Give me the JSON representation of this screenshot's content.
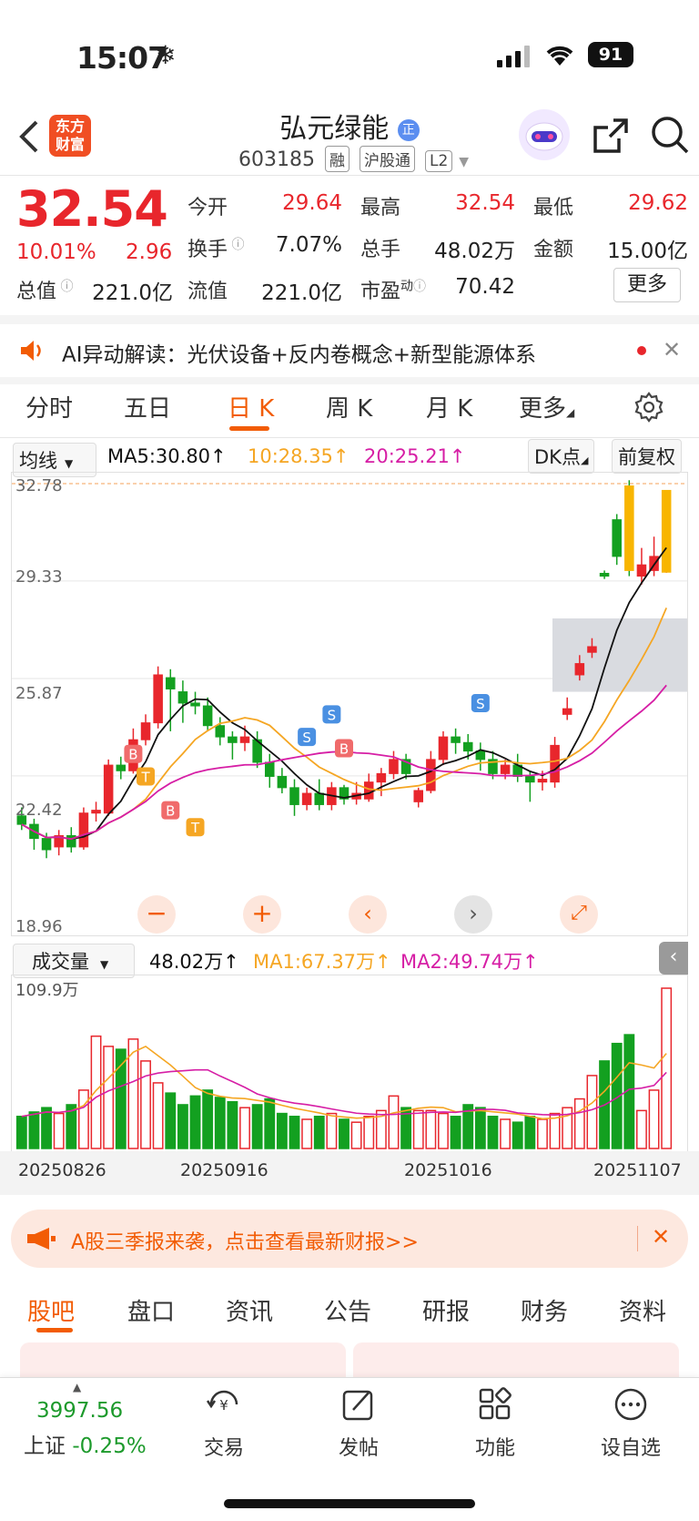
{
  "status": {
    "time": "15:07",
    "battery": "91"
  },
  "header": {
    "logo_line1": "东方",
    "logo_line2": "财富",
    "title": "弘元绿能",
    "title_badge": "正",
    "code": "603185",
    "tags": [
      "融",
      "沪股通",
      "L2"
    ]
  },
  "quote": {
    "price": "32.54",
    "change_pct": "10.01%",
    "change": "2.96",
    "stats": [
      {
        "label": "今开",
        "value": "29.64"
      },
      {
        "label": "最高",
        "value": "32.54"
      },
      {
        "label": "最低",
        "value": "29.62"
      },
      {
        "label": "换手",
        "value": "7.07%"
      },
      {
        "label": "总手",
        "value": "48.02万"
      },
      {
        "label": "金额",
        "value": "15.00亿"
      },
      {
        "label": "总值",
        "value": "221.0亿"
      },
      {
        "label": "流值",
        "value": "221.0亿"
      },
      {
        "label": "市盈",
        "value": "70.42"
      }
    ],
    "pe_sup": "动",
    "more": "更多"
  },
  "ai_banner": {
    "text": "AI异动解读：光伏设备+反内卷概念+新型能源体系"
  },
  "tabs": [
    "分时",
    "五日",
    "日 K",
    "周 K",
    "月 K",
    "更多"
  ],
  "kline": {
    "indicator": "均线",
    "ma5": "MA5:30.80",
    "ma10": "10:28.35",
    "ma20": "20:25.21",
    "dk_label": "DK点",
    "fq_label": "前复权",
    "y_ticks": [
      "32.78",
      "29.33",
      "25.87",
      "22.42",
      "18.96"
    ],
    "markers": [
      "B",
      "T",
      "B",
      "T",
      "S",
      "S",
      "B",
      "S"
    ]
  },
  "volume": {
    "indicator": "成交量",
    "value": "48.02万",
    "ma1": "MA1:67.37万",
    "ma2": "MA2:49.74万",
    "max_label": "109.9万",
    "dates": [
      "20250826",
      "20250916",
      "20251016",
      "20251107"
    ]
  },
  "colors": {
    "up": "#e8262c",
    "down": "#13a020",
    "ma5": "#111111",
    "ma10": "#f5a623",
    "ma20": "#d61ea5",
    "accent": "#f25c05"
  },
  "chart_data": {
    "type": "candlestick",
    "y_range": [
      18.96,
      32.78
    ],
    "candles": [
      [
        21.0,
        20.7,
        21.3,
        20.5
      ],
      [
        20.7,
        20.2,
        20.9,
        19.8
      ],
      [
        20.2,
        19.8,
        20.4,
        19.5
      ],
      [
        19.9,
        20.3,
        20.5,
        19.6
      ],
      [
        20.3,
        19.9,
        20.6,
        19.7
      ],
      [
        19.9,
        21.1,
        21.3,
        19.8
      ],
      [
        21.1,
        21.2,
        21.5,
        20.8
      ],
      [
        21.1,
        22.8,
        23.0,
        21.0
      ],
      [
        22.8,
        22.6,
        23.1,
        22.3
      ],
      [
        22.6,
        23.7,
        24.1,
        22.5
      ],
      [
        23.7,
        24.3,
        24.6,
        23.5
      ],
      [
        24.3,
        26.0,
        26.3,
        24.1
      ],
      [
        25.9,
        25.5,
        26.2,
        24.0
      ],
      [
        25.4,
        25.0,
        25.8,
        24.3
      ],
      [
        25.0,
        24.9,
        25.4,
        24.6
      ],
      [
        24.9,
        24.2,
        25.2,
        24.0
      ],
      [
        24.2,
        23.8,
        24.5,
        23.5
      ],
      [
        23.8,
        23.6,
        24.0,
        23.0
      ],
      [
        23.6,
        23.8,
        24.2,
        23.3
      ],
      [
        23.7,
        22.9,
        24.0,
        22.7
      ],
      [
        22.9,
        22.4,
        23.2,
        22.0
      ],
      [
        22.4,
        22.0,
        22.7,
        21.8
      ],
      [
        22.0,
        21.4,
        22.3,
        21.0
      ],
      [
        21.4,
        21.8,
        22.0,
        21.2
      ],
      [
        21.8,
        21.4,
        22.3,
        21.2
      ],
      [
        21.4,
        22.0,
        22.2,
        21.2
      ],
      [
        22.0,
        21.6,
        22.1,
        21.4
      ],
      [
        21.6,
        21.8,
        22.2,
        21.4
      ],
      [
        21.6,
        22.2,
        22.5,
        21.5
      ],
      [
        22.2,
        22.5,
        22.7,
        21.7
      ],
      [
        22.5,
        23.0,
        23.3,
        22.3
      ],
      [
        23.0,
        22.5,
        23.2,
        22.3
      ],
      [
        21.5,
        21.9,
        22.0,
        21.3
      ],
      [
        21.9,
        23.0,
        23.3,
        21.8
      ],
      [
        23.0,
        23.8,
        24.0,
        22.8
      ],
      [
        23.8,
        23.6,
        24.1,
        23.2
      ],
      [
        23.6,
        23.3,
        23.9,
        23.0
      ],
      [
        23.3,
        23.0,
        23.6,
        22.6
      ],
      [
        23.0,
        22.5,
        23.3,
        22.3
      ],
      [
        22.5,
        22.8,
        23.0,
        22.3
      ],
      [
        22.8,
        22.4,
        23.2,
        22.2
      ],
      [
        22.4,
        22.2,
        22.6,
        21.5
      ],
      [
        22.2,
        22.3,
        22.6,
        21.9
      ],
      [
        22.2,
        23.5,
        23.8,
        22.0
      ],
      [
        24.6,
        24.8,
        25.2,
        24.4
      ],
      [
        26.0,
        26.4,
        26.7,
        25.8
      ],
      [
        26.8,
        27.0,
        27.3,
        26.6
      ],
      [
        29.6,
        29.5,
        29.7,
        29.4
      ],
      [
        31.5,
        30.2,
        31.7,
        29.9
      ],
      [
        32.7,
        29.7,
        32.9,
        29.5
      ],
      [
        29.5,
        29.9,
        30.5,
        29.2
      ],
      [
        29.7,
        30.2,
        30.9,
        29.5
      ],
      [
        29.64,
        32.54,
        32.54,
        29.62
      ]
    ],
    "volume": [
      22,
      25,
      28,
      24,
      30,
      40,
      77,
      70,
      68,
      75,
      60,
      45,
      38,
      30,
      36,
      40,
      35,
      32,
      28,
      30,
      34,
      24,
      22,
      20,
      22,
      24,
      20,
      18,
      22,
      26,
      36,
      28,
      26,
      26,
      24,
      22,
      30,
      28,
      22,
      20,
      18,
      22,
      20,
      24,
      28,
      34,
      50,
      60,
      72,
      78,
      26,
      40,
      109.9
    ]
  }
}
